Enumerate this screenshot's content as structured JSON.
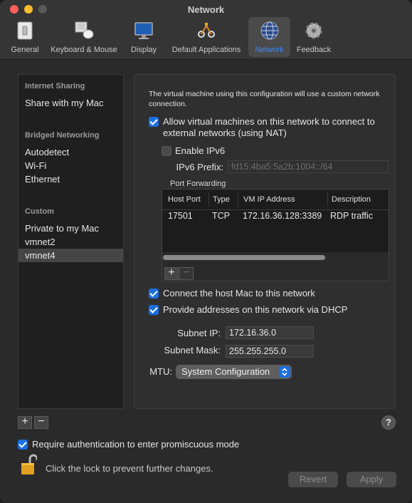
{
  "window": {
    "title": "Network"
  },
  "toolbar": {
    "items": [
      {
        "label": "General",
        "icon": "general-icon"
      },
      {
        "label": "Keyboard & Mouse",
        "icon": "keyboard-mouse-icon"
      },
      {
        "label": "Display",
        "icon": "display-icon"
      },
      {
        "label": "Default Applications",
        "icon": "default-applications-icon"
      },
      {
        "label": "Network",
        "icon": "network-globe-icon",
        "selected": true
      },
      {
        "label": "Feedback",
        "icon": "gear-icon"
      }
    ]
  },
  "sidebar": {
    "sections": [
      {
        "header": "Internet Sharing",
        "items": [
          "Share with my Mac"
        ]
      },
      {
        "header": "Bridged Networking",
        "items": [
          "Autodetect",
          "Wi-Fi",
          "Ethernet"
        ]
      },
      {
        "header": "Custom",
        "items": [
          "Private to my Mac",
          "vmnet2",
          "vmnet4"
        ]
      }
    ],
    "selected": "vmnet4",
    "add_label": "+",
    "remove_label": "−"
  },
  "panel": {
    "description": "The virtual machine using this configuration will use a custom network connection.",
    "nat": {
      "label": "Allow virtual machines on this network to connect to external networks (using NAT)",
      "checked": true
    },
    "ipv6": {
      "label": "Enable IPv6",
      "checked": false
    },
    "ipv6_prefix": {
      "label": "IPv6 Prefix:",
      "value": "fd15:4ba5:5a2b:1004::/64"
    },
    "port_forwarding": {
      "title": "Port Forwarding",
      "columns": [
        "Host Port",
        "Type",
        "VM IP Address",
        "Description"
      ],
      "rows": [
        {
          "host_port": "17501",
          "type": "TCP",
          "vm_ip": "172.16.36.128:3389",
          "description": "RDP traffic"
        }
      ],
      "add_label": "+",
      "remove_label": "−"
    },
    "connect_host": {
      "label": "Connect the host Mac to this network",
      "checked": true
    },
    "dhcp": {
      "label": "Provide addresses on this network via DHCP",
      "checked": true
    },
    "subnet_ip": {
      "label": "Subnet IP:",
      "value": "172.16.36.0"
    },
    "subnet_mask": {
      "label": "Subnet Mask:",
      "value": "255.255.255.0"
    },
    "mtu": {
      "label": "MTU:",
      "value": "System Configuration"
    }
  },
  "footer": {
    "help_label": "?",
    "promiscuous": {
      "label": "Require authentication to enter promiscuous mode",
      "checked": true
    },
    "lock_text": "Click the lock to prevent further changes.",
    "revert_label": "Revert",
    "apply_label": "Apply"
  },
  "colors": {
    "accent": "#1a6fe0",
    "selected_tab": "#3a86ff"
  }
}
